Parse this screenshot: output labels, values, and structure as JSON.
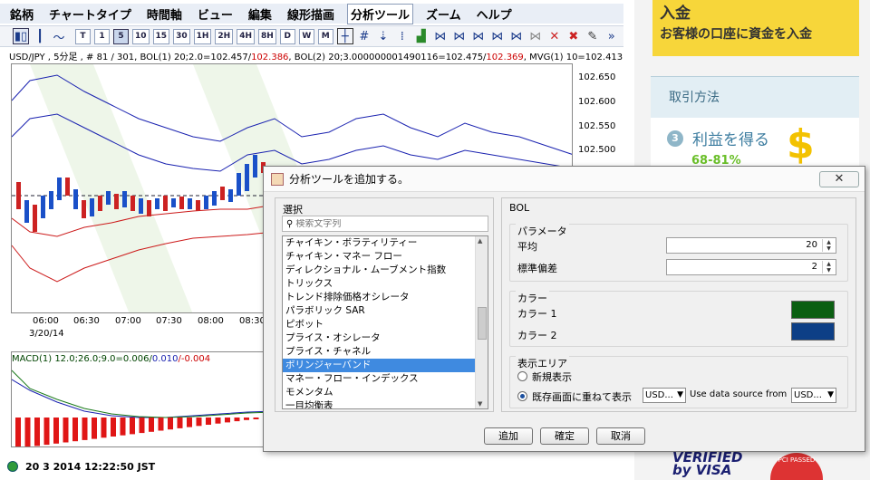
{
  "menubar": {
    "items": [
      "銘柄",
      "チャートタイプ",
      "時間軸",
      "ビュー",
      "編集",
      "線形描画",
      "分析ツール",
      "ズーム",
      "ヘルプ"
    ]
  },
  "toolbar": {
    "timeframes": [
      "T",
      "1",
      "5",
      "10",
      "15",
      "30",
      "1H",
      "2H",
      "4H",
      "8H",
      "D",
      "W",
      "M"
    ],
    "selected_timeframe": "5",
    "more_label": "»"
  },
  "info_line": {
    "prefix": "USD/JPY , 5分足 , # 81 / 301, BOL(1) 20;2.0=102.457/",
    "red1": "102.386",
    "mid": ", BOL(2) 20;3.000000001490116=102.475/",
    "red2": "102.369",
    "suffix": ", MVG(1) 10=102.413"
  },
  "y_axis_labels": [
    "102.650",
    "102.600",
    "102.550",
    "102.500"
  ],
  "x_axis_labels": [
    "06:00",
    "06:30",
    "07:00",
    "07:30",
    "08:00",
    "08:30"
  ],
  "x_axis_date": "3/20/14",
  "macd_label": {
    "text": "MACD(1) 12.0;26.0;9.0=0.006/",
    "blue": "0.010",
    "red": "/-0.004"
  },
  "status": {
    "datetime": "20 3 2014 12:22:50 JST"
  },
  "sidebar": {
    "banner_title": "入金",
    "banner_sub": "お客様の口座に資金を入金",
    "section_title": "取引方法",
    "step_number": "3",
    "step_text": "利益を得る",
    "percent": "68-81%",
    "dollar": "$",
    "visa_line1": "VERIFIED",
    "visa_line2": "by VISA",
    "pci_text": "PCI PASSED"
  },
  "dialog": {
    "title": "分析ツールを追加する。",
    "close_label": "✕",
    "left_header": "選択",
    "search_placeholder": "検索文字列",
    "items": [
      "チャイキン・ボラティリティー",
      "チャイキン・マネー フロー",
      "ディレクショナル・ムーブメント指数",
      "トリックス",
      "トレンド排除価格オシレータ",
      "パラボリック SAR",
      "ピボット",
      "プライス・オシレータ",
      "プライス・チャネル",
      "ボリンジャーバンド",
      "マネー・フロー・インデックス",
      "モメンタム",
      "一目均衡表"
    ],
    "selected_index": 9,
    "right_header": "BOL",
    "params_header": "パラメータ",
    "param_avg_label": "平均",
    "param_avg_value": "20",
    "param_dev_label": "標準偏差",
    "param_dev_value": "2",
    "color_header": "カラー",
    "color1_label": "カラー 1",
    "color1": "#0b5f12",
    "color2_label": "カラー 2",
    "color2": "#0d3f86",
    "area_header": "表示エリア",
    "radio_new": "新規表示",
    "radio_overlay": "既存画面に重ねて表示",
    "overlay_select": "USD...",
    "datasource_label": "Use data source from",
    "datasource_select": "USD...",
    "btn_add": "追加",
    "btn_ok": "確定",
    "btn_cancel": "取消"
  }
}
